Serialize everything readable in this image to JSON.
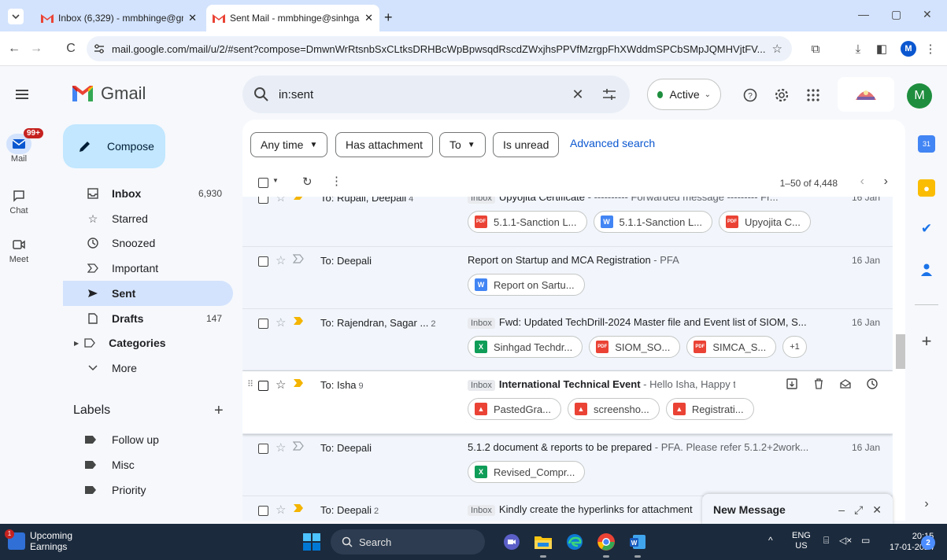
{
  "browser": {
    "tabs": [
      {
        "label": "Inbox (6,329) - mmbhinge@gm",
        "active": false
      },
      {
        "label": "Sent Mail - mmbhinge@sinhga",
        "active": true
      }
    ],
    "url": "mail.google.com/mail/u/2/#sent?compose=DmwnWrRtsnbSxCLtksDRHBcWpBpwsqdRscdZWxjhsPPVfMzrgpFhXWddmSPCbSMpJQMHVjtFV...",
    "profile_initial": "M"
  },
  "gmail": {
    "brand": "Gmail",
    "search_query": "in:sent",
    "status": "Active",
    "avatar_initial": "M",
    "rail": [
      {
        "label": "Mail",
        "badge": "99+"
      },
      {
        "label": "Chat"
      },
      {
        "label": "Meet"
      }
    ],
    "compose_label": "Compose",
    "nav": [
      {
        "label": "Inbox",
        "count": "6,930",
        "bold": true,
        "icon": "inbox-icon"
      },
      {
        "label": "Starred",
        "count": "",
        "bold": false,
        "icon": "star-icon"
      },
      {
        "label": "Snoozed",
        "count": "",
        "bold": false,
        "icon": "clock-icon"
      },
      {
        "label": "Important",
        "count": "",
        "bold": false,
        "icon": "important-icon"
      },
      {
        "label": "Sent",
        "count": "",
        "bold": true,
        "selected": true,
        "icon": "send-icon"
      },
      {
        "label": "Drafts",
        "count": "147",
        "bold": true,
        "icon": "draft-icon"
      },
      {
        "label": "Categories",
        "count": "",
        "bold": true,
        "icon": "label-outline-icon"
      },
      {
        "label": "More",
        "count": "",
        "bold": false,
        "icon": "chevron-down-icon"
      }
    ],
    "labels_title": "Labels",
    "labels": [
      "Follow up",
      "Misc",
      "Priority"
    ],
    "filters": {
      "any_time": "Any time",
      "has_attachment": "Has attachment",
      "to": "To",
      "is_unread": "Is unread",
      "advanced": "Advanced search"
    },
    "pager": "1–50 of 4,448",
    "rows": [
      {
        "to": "To: Rupali, Deepali",
        "count": "4",
        "tag": "Inbox",
        "subject": "Upyojita Certificate",
        "snippet": " - ---------- Forwarded message --------- Fr...",
        "date": "16 Jan",
        "attachments": [
          {
            "type": "pdf",
            "name": "5.1.1-Sanction L..."
          },
          {
            "type": "word",
            "name": "5.1.1-Sanction L..."
          },
          {
            "type": "pdf",
            "name": "Upyojita C..."
          }
        ]
      },
      {
        "to": "To: Deepali",
        "count": "",
        "tag": "",
        "subject": "Report on Startup and MCA Registration",
        "snippet": " - PFA",
        "date": "16 Jan",
        "attachments": [
          {
            "type": "word",
            "name": "Report on Sartu..."
          }
        ]
      },
      {
        "to": "To: Rajendran, Sagar ...",
        "count": "2",
        "tag": "Inbox",
        "subject": "Fwd: Updated TechDrill-2024 Master file and Event list of SIOM, S...",
        "snippet": "",
        "date": "16 Jan",
        "attachments": [
          {
            "type": "xls",
            "name": "Sinhgad Techdr..."
          },
          {
            "type": "pdf",
            "name": "SIOM_SO..."
          },
          {
            "type": "pdf",
            "name": "SIMCA_S..."
          }
        ],
        "more": "+1"
      },
      {
        "to": "To: Isha",
        "count": "9",
        "tag": "Inbox",
        "subject": "International Technical Event",
        "snippet": " - Hello Isha, Happy to ...",
        "date": "",
        "attachments": [
          {
            "type": "img",
            "name": "PastedGra..."
          },
          {
            "type": "img",
            "name": "screensho..."
          },
          {
            "type": "img",
            "name": "Registrati..."
          }
        ]
      },
      {
        "to": "To: Deepali",
        "count": "",
        "tag": "",
        "subject": "5.1.2 document & reports to be prepared",
        "snippet": " - PFA. Please refer 5.1.2+2work...",
        "date": "16 Jan",
        "attachments": [
          {
            "type": "xls",
            "name": "Revised_Compr..."
          }
        ]
      },
      {
        "to": "To: Deepali",
        "count": "2",
        "tag": "Inbox",
        "subject": "Kindly create the hyperlinks for attachment",
        "snippet": "",
        "date": "",
        "attachments": []
      }
    ],
    "new_message": "New Message"
  },
  "taskbar": {
    "widget_title": "Upcoming",
    "widget_sub": "Earnings",
    "widget_badge": "1",
    "search": "Search",
    "lang_top": "ENG",
    "lang_bottom": "US",
    "time": "20:15",
    "date": "17-01-2024",
    "notif": "2"
  }
}
